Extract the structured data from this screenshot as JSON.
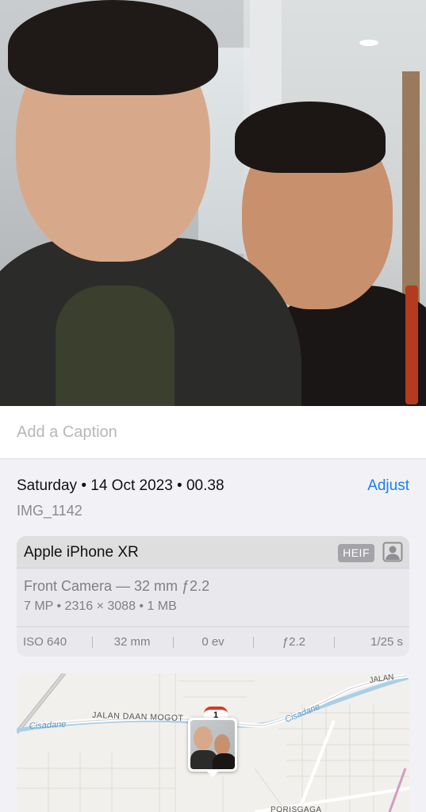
{
  "photo": {
    "alt": "Selfie of two men indoors"
  },
  "caption": {
    "placeholder": "Add a Caption"
  },
  "info": {
    "date": "Saturday • 14 Oct 2023 • 00.38",
    "adjust_label": "Adjust",
    "filename": "IMG_1142"
  },
  "camera": {
    "device": "Apple iPhone XR",
    "format_badge": "HEIF",
    "lens": "Front Camera — 32 mm ƒ2.2",
    "specs": "7 MP  •  2316 × 3088  •  1 MB",
    "exif": [
      "ISO 640",
      "32 mm",
      "0 ev",
      "ƒ2.2",
      "1/25 s"
    ]
  },
  "map": {
    "labels": [
      "Cisadane",
      "JALAN DAAN MOGOT",
      "Cisadane",
      "JALAN",
      "PORISGAGA"
    ],
    "pin_count": "1"
  },
  "icons": {
    "portrait": "portrait-person-icon"
  }
}
